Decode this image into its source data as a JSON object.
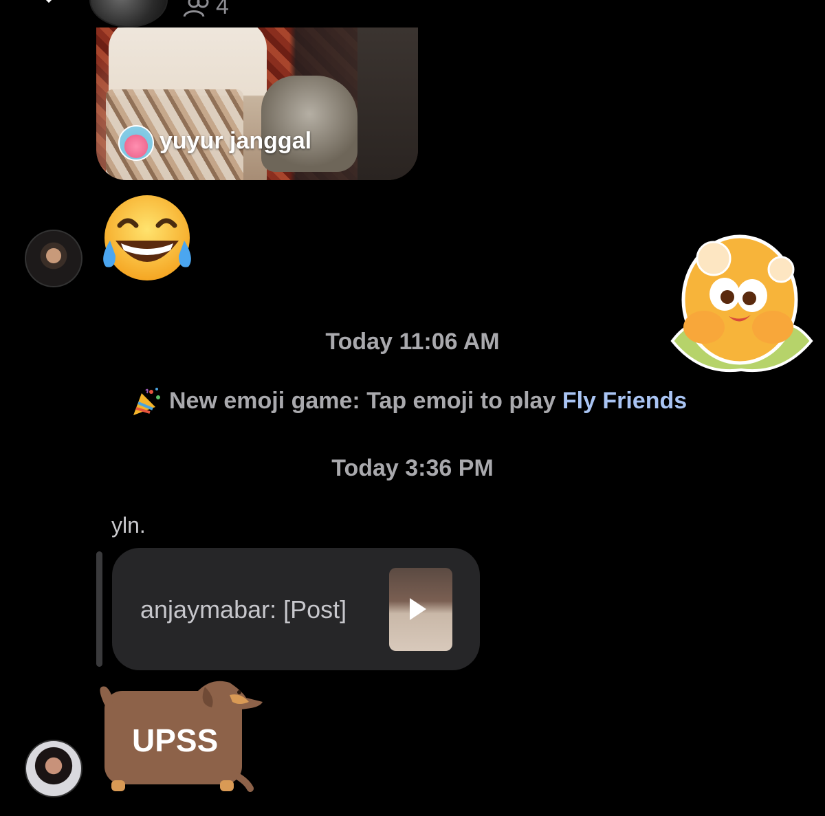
{
  "header": {
    "member_count": "4"
  },
  "video_card": {
    "poster_name": "yuyur janggal"
  },
  "messages": {
    "timestamp_1": "Today 11:06 AM",
    "announcement": {
      "text": "New emoji game: Tap emoji to play ",
      "link": "Fly Friends"
    },
    "timestamp_2": "Today 3:36 PM",
    "sender_name": "yln.",
    "reply": {
      "text": "anjaymabar: [Post]"
    },
    "sticker_upss_text": "UPSS"
  },
  "colors": {
    "background": "#000000",
    "timestamp_text": "#a9a9ad",
    "link": "#a9c4f3",
    "bubble": "#262628"
  },
  "icons": [
    "chevron-down-icon",
    "people-icon",
    "face-with-tears-of-joy-emoji",
    "party-popper-emoji",
    "play-icon"
  ]
}
